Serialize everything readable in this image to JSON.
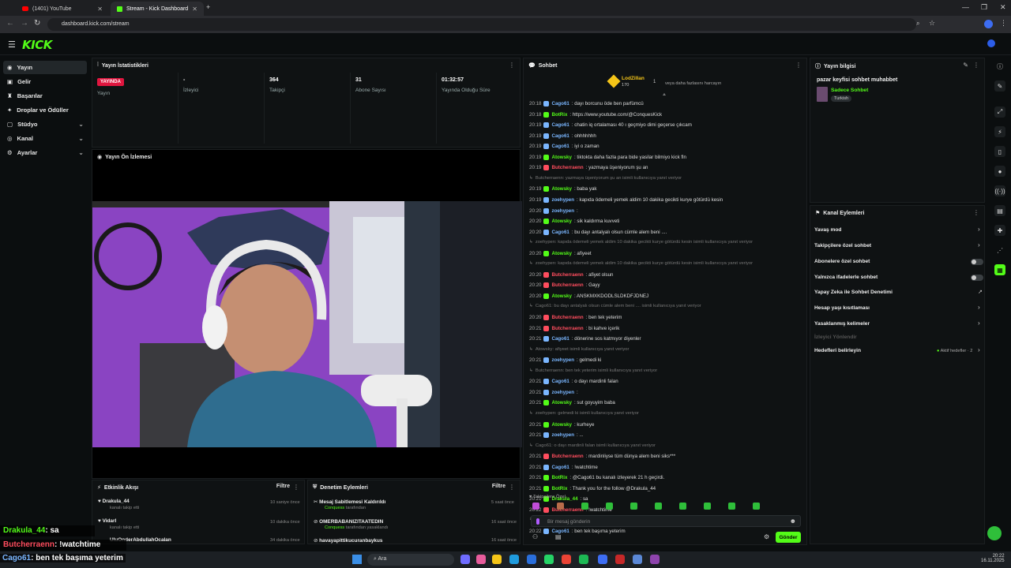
{
  "browser": {
    "tabs": [
      {
        "label": "(1401) YouTube"
      },
      {
        "label": "Stream - Kick Dashboard"
      }
    ],
    "url": "dashboard.kick.com/stream"
  },
  "brand": {
    "logo": "KICK",
    "accent": "#53fc18"
  },
  "sidebar": {
    "items": [
      {
        "label": "Yayın",
        "icon": "broadcast-icon"
      },
      {
        "label": "Gelir",
        "icon": "money-icon"
      },
      {
        "label": "Başarılar",
        "icon": "trophy-icon"
      },
      {
        "label": "Droplar ve Ödüller",
        "icon": "gift-icon"
      },
      {
        "label": "Stüdyo",
        "icon": "studio-icon"
      },
      {
        "label": "Kanal",
        "icon": "channel-icon"
      },
      {
        "label": "Ayarlar",
        "icon": "gear-icon"
      }
    ]
  },
  "stats": {
    "title": "Yayın İstatistikleri",
    "live_badge": "YAYINDA",
    "items": [
      {
        "value": "",
        "label": "Yayın"
      },
      {
        "value": "-",
        "label": "İzleyici"
      },
      {
        "value": "364",
        "label": "Takipçi"
      },
      {
        "value": "31",
        "label": "Abone Sayısı"
      },
      {
        "value": "01:32:57",
        "label": "Yayında Olduğu Süre"
      }
    ]
  },
  "preview": {
    "title": "Yayın Ön İzlemesi"
  },
  "chat": {
    "title": "Sohbet",
    "top_user": "LodZillan",
    "top_amount": "170",
    "top_note": "veya daha fazlasını harcayın",
    "top_count": "1",
    "messages": [
      {
        "time": "20:18",
        "user": "Cago61",
        "color": "#7ab6ff",
        "text": ": dayı borcunu öde ben parfümcü"
      },
      {
        "time": "20:18",
        "user": "BotRix",
        "color": "#53fc18",
        "text": ": https://www.youtube.com/@ConquesKick"
      },
      {
        "time": "20:19",
        "user": "Cago61",
        "color": "#7ab6ff",
        "text": ": chatin iq ortalaması 40 ı geçmiyo dimi geçerse çıkcam"
      },
      {
        "time": "20:19",
        "user": "Cago61",
        "color": "#7ab6ff",
        "text": ": ohhhhhhh"
      },
      {
        "time": "20:19",
        "user": "Cago61",
        "color": "#7ab6ff",
        "text": ": iyi o zaman"
      },
      {
        "time": "20:19",
        "user": "Atowsky",
        "color": "#53fc18",
        "text": ": tiktokta daha fazla para bide yasilar bilmiyo kick fln"
      },
      {
        "time": "20:19",
        "user": "Butcherraenn",
        "color": "#ff4d5e",
        "text": ": yazmaya üşeniyorum şu an"
      },
      {
        "sys": "Butcherraenn: yazmaya üşeniyorum şu an isimli kullanıcıya yanıt veriyor"
      },
      {
        "time": "20:19",
        "user": "Atowsky",
        "color": "#53fc18",
        "text": ": baba yak"
      },
      {
        "time": "20:19",
        "user": "zoehypen",
        "color": "#7ab6ff",
        "text": ": kapıda ödemeli yemek aldim 10 dakika gecikti kurye götürdü kesin"
      },
      {
        "time": "20:20",
        "user": "zoehypen",
        "color": "#7ab6ff",
        "text": ":"
      },
      {
        "time": "20:20",
        "user": "Atowsky",
        "color": "#53fc18",
        "text": ": sik kaldırma kuvveti"
      },
      {
        "time": "20:20",
        "user": "Cago61",
        "color": "#7ab6ff",
        "text": ": bu dayı antalyalı olsun cümle alem beni ...."
      },
      {
        "sys": "zoehypen: kapıda ödemeli yemek aldim 10 dakika gecikti kurye götürdü kesin isimli kullanıcıya yanıt veriyor"
      },
      {
        "time": "20:20",
        "user": "Atowsky",
        "color": "#53fc18",
        "text": ": afiyeet"
      },
      {
        "sys": "zoehypen: kapıda ödemeli yemek aldim 10 dakika gecikti kurye götürdü kesin isimli kullanıcıya yanıt veriyor"
      },
      {
        "time": "20:20",
        "user": "Butcherraenn",
        "color": "#ff4d5e",
        "text": ": afiyet olsun"
      },
      {
        "time": "20:20",
        "user": "Butcherraenn",
        "color": "#ff4d5e",
        "text": ": Gayy"
      },
      {
        "time": "20:20",
        "user": "Atowsky",
        "color": "#53fc18",
        "text": ": ANSKMXKDODLSLDKDFJDNEJ"
      },
      {
        "sys": "Cago61: bu dayı antalyalı olsun cümle alem beni .... isimli kullanıcıya yanıt veriyor"
      },
      {
        "time": "20:20",
        "user": "Butcherraenn",
        "color": "#ff4d5e",
        "text": ": ben tek yeterim"
      },
      {
        "time": "20:21",
        "user": "Butcherraenn",
        "color": "#ff4d5e",
        "text": ": bi kahve içerik"
      },
      {
        "time": "20:21",
        "user": "Cago61",
        "color": "#7ab6ff",
        "text": ": dönerine sos katmıyor diyenler"
      },
      {
        "sys": "Atowsky: afiyeet isimli kullanıcıya yanıt veriyor"
      },
      {
        "time": "20:21",
        "user": "zoehypen",
        "color": "#7ab6ff",
        "text": ": gelmedi ki"
      },
      {
        "sys": "Butcherraenn: ben tek yeterim isimli kullanıcıya yanıt veriyor"
      },
      {
        "time": "20:21",
        "user": "Cago61",
        "color": "#7ab6ff",
        "text": ": o dayı mardinli falan"
      },
      {
        "time": "20:21",
        "user": "zoehypen",
        "color": "#7ab6ff",
        "text": ":"
      },
      {
        "time": "20:21",
        "user": "Atowsky",
        "color": "#53fc18",
        "text": ": sut goyuyim baba"
      },
      {
        "sys": "zoehypen: gelmedi ki isimli kullanıcıya yanıt veriyor"
      },
      {
        "time": "20:21",
        "user": "Atowsky",
        "color": "#53fc18",
        "text": ": kurheye"
      },
      {
        "time": "20:21",
        "user": "zoehypen",
        "color": "#7ab6ff",
        "text": ": ..."
      },
      {
        "sys": "Cago61: o dayı mardinli falan isimli kullanıcıya yanıt veriyor"
      },
      {
        "time": "20:21",
        "user": "Butcherraenn",
        "color": "#ff4d5e",
        "text": ": mardinliyse tüm dünya alem beni siks***"
      },
      {
        "time": "20:21",
        "user": "Cago61",
        "color": "#7ab6ff",
        "text": ": !watchtime"
      },
      {
        "time": "20:21",
        "user": "BotRix",
        "color": "#53fc18",
        "text": ": @Cago61 bu kanalı izleyerek 21 h geçirdi."
      },
      {
        "time": "20:21",
        "user": "BotRix",
        "color": "#53fc18",
        "text": ": Thank you for the follow @Drakula_44"
      },
      {
        "time": "20:21",
        "user": "Drakula_44",
        "color": "#53fc18",
        "text": ": sa"
      },
      {
        "time": "20:22",
        "user": "Butcherraenn",
        "color": "#ff4d5e",
        "text": ": !watchtime"
      },
      {
        "sys": "Butcherraenn: mardinliyse tüm dünya alem beni siks*** isimli kullanıcıya yanıt veriyor"
      },
      {
        "time": "20:22",
        "user": "Cago61",
        "color": "#7ab6ff",
        "text": ": ben tek başıma yeterim"
      }
    ],
    "follower_only": "Takipçilere Özel",
    "input_placeholder": "Bir mesaj gönderin",
    "send_label": "Gönder"
  },
  "stream_info": {
    "title": "Yayın bilgisi",
    "stream_title": "pazar keyfisi sohbet muhabbet",
    "category": "Sadece Sohbet",
    "tag": "Turkish"
  },
  "channel_actions": {
    "title": "Kanal Eylemleri",
    "items": [
      {
        "label": "Yavaş mod",
        "type": "chevron"
      },
      {
        "label": "Takipçilere özel sohbet",
        "type": "chevron"
      },
      {
        "label": "Abonelere özel sohbet",
        "type": "toggle"
      },
      {
        "label": "Yalnızca ifadelerle sohbet",
        "type": "toggle"
      },
      {
        "label": "Yapay Zeka ile Sohbet Denetimi",
        "type": "link"
      },
      {
        "label": "Hesap yaşı kısıtlaması",
        "type": "chevron"
      },
      {
        "label": "Yasaklanmış kelimeler",
        "type": "chevron"
      },
      {
        "label": "İzleyici Yönlendir",
        "type": "disabled"
      },
      {
        "label": "Hedefleri belirleyin",
        "type": "chevron"
      }
    ],
    "goals_status": "Aktif hedefler · 2"
  },
  "activity": {
    "title": "Etkinlik Akışı",
    "filter": "Filtre",
    "items": [
      {
        "name": "Drakula_44",
        "sub": "kanalı takip etti",
        "ago": "10 saniye önce"
      },
      {
        "name": "Vidarl",
        "sub": "kanalı takip etti",
        "ago": "10 dakika önce"
      },
      {
        "name": "UluOnderAbdullahOcalan",
        "sub": "",
        "ago": "34 dakika önce"
      }
    ]
  },
  "moderation": {
    "title": "Denetim Eylemleri",
    "filter": "Filtre",
    "items": [
      {
        "name": "Mesaj Sabitlemesi Kaldırıldı",
        "by": "Conquess",
        "sub": "tarafından",
        "ago": "5 saat önce"
      },
      {
        "name": "OMERBABANIZITAATEDIN",
        "by": "Conquess",
        "sub": "tarafından yasaklandı",
        "ago": "16 saat önce"
      },
      {
        "name": "havayapittikucuranbaykus",
        "by": "",
        "sub": "",
        "ago": "16 saat önce"
      }
    ]
  },
  "overlay": {
    "line1_user": "Drakula_44",
    "line1_text": ": sa",
    "line2_user": "Butcherraenn",
    "line2_text": ": !watchtime",
    "line3_user": "Cago61",
    "line3_text": ": ben tek başıma yeterim"
  },
  "taskbar": {
    "search": "Ara",
    "time": "20:22",
    "date": "16.11.2025"
  }
}
